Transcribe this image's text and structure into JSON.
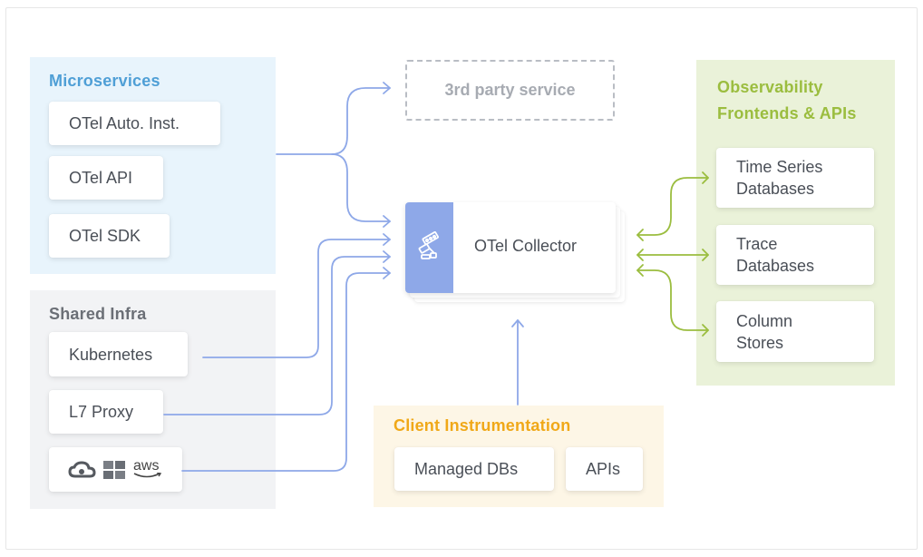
{
  "microservices": {
    "title": "Microservices",
    "items": [
      "OTel Auto. Inst.",
      "OTel API",
      "OTel SDK"
    ]
  },
  "shared_infra": {
    "title": "Shared Infra",
    "items": [
      "Kubernetes",
      "L7 Proxy"
    ],
    "cloud_logos": {
      "aws": "aws"
    }
  },
  "third_party": {
    "label": "3rd party service"
  },
  "collector": {
    "label": "OTel Collector"
  },
  "observability": {
    "title": "Observability Frontends & APIs",
    "items": [
      {
        "line1": "Time Series",
        "line2": "Databases"
      },
      {
        "line1": "Trace",
        "line2": "Databases"
      },
      {
        "line1": "Column",
        "line2": "Stores"
      }
    ]
  },
  "client_instrumentation": {
    "title": "Client Instrumentation",
    "items": [
      "Managed DBs",
      "APIs"
    ]
  },
  "colors": {
    "blue_arrow": "#8ea8e8",
    "green_arrow": "#9bbd3f",
    "microservices_title": "#4f9fd6",
    "observability_title": "#9bbd3f",
    "client_title": "#f0a818"
  }
}
